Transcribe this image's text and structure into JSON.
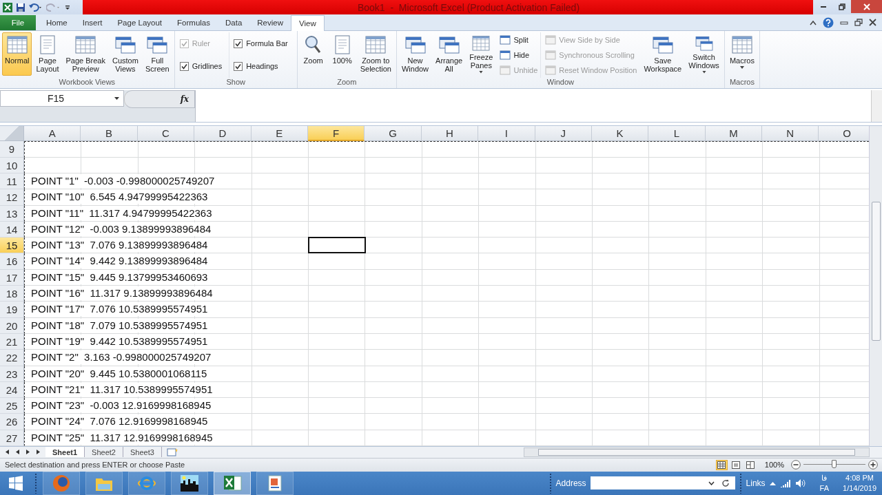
{
  "window": {
    "title": "Book1  -  Microsoft Excel (Product Activation Failed)"
  },
  "ribbon_tabs": [
    {
      "label": "File",
      "kind": "file",
      "selected": false
    },
    {
      "label": "Home",
      "kind": "tab",
      "selected": false
    },
    {
      "label": "Insert",
      "kind": "tab",
      "selected": false
    },
    {
      "label": "Page Layout",
      "kind": "tab",
      "selected": false
    },
    {
      "label": "Formulas",
      "kind": "tab",
      "selected": false
    },
    {
      "label": "Data",
      "kind": "tab",
      "selected": false
    },
    {
      "label": "Review",
      "kind": "tab",
      "selected": false
    },
    {
      "label": "View",
      "kind": "tab",
      "selected": true
    }
  ],
  "ribbon_groups": [
    {
      "label": "Workbook Views",
      "items": [
        {
          "kind": "large",
          "lines": [
            "Normal"
          ],
          "selected": true,
          "dropdown": false
        },
        {
          "kind": "large",
          "lines": [
            "Page",
            "Layout"
          ],
          "selected": false,
          "dropdown": false
        },
        {
          "kind": "large",
          "lines": [
            "Page Break",
            "Preview"
          ],
          "selected": false,
          "dropdown": false
        },
        {
          "kind": "large",
          "lines": [
            "Custom",
            "Views"
          ],
          "selected": false,
          "dropdown": false
        },
        {
          "kind": "large",
          "lines": [
            "Full",
            "Screen"
          ],
          "selected": false,
          "dropdown": false
        }
      ]
    },
    {
      "label": "Show",
      "items": [
        {
          "kind": "stack",
          "items": [
            {
              "kind": "check",
              "label": "Ruler",
              "checked": true,
              "disabled": true
            },
            {
              "kind": "check",
              "label": "Gridlines",
              "checked": true,
              "disabled": false
            }
          ]
        },
        {
          "kind": "stack",
          "items": [
            {
              "kind": "check",
              "label": "Formula Bar",
              "checked": true,
              "disabled": false
            },
            {
              "kind": "check",
              "label": "Headings",
              "checked": true,
              "disabled": false
            }
          ]
        }
      ]
    },
    {
      "label": "Zoom",
      "items": [
        {
          "kind": "large",
          "lines": [
            "Zoom"
          ],
          "selected": false,
          "dropdown": false
        },
        {
          "kind": "large",
          "lines": [
            "100%"
          ],
          "selected": false,
          "dropdown": false
        },
        {
          "kind": "large",
          "lines": [
            "Zoom to",
            "Selection"
          ],
          "selected": false,
          "dropdown": false
        }
      ]
    },
    {
      "label": "Window",
      "items": [
        {
          "kind": "large",
          "lines": [
            "New",
            "Window"
          ],
          "selected": false,
          "dropdown": false
        },
        {
          "kind": "large",
          "lines": [
            "Arrange",
            "All"
          ],
          "selected": false,
          "dropdown": false
        },
        {
          "kind": "large",
          "lines": [
            "Freeze",
            "Panes"
          ],
          "selected": false,
          "dropdown": true
        },
        {
          "kind": "stack",
          "items": [
            {
              "kind": "small",
              "label": "Split",
              "disabled": false
            },
            {
              "kind": "small",
              "label": "Hide",
              "disabled": false
            },
            {
              "kind": "small",
              "label": "Unhide",
              "disabled": true
            }
          ]
        },
        {
          "kind": "stack",
          "items": [
            {
              "kind": "small",
              "label": "View Side by Side",
              "disabled": true
            },
            {
              "kind": "small",
              "label": "Synchronous Scrolling",
              "disabled": true
            },
            {
              "kind": "small",
              "label": "Reset Window Position",
              "disabled": true
            }
          ]
        },
        {
          "kind": "large",
          "lines": [
            "Save",
            "Workspace"
          ],
          "selected": false,
          "dropdown": false
        },
        {
          "kind": "large",
          "lines": [
            "Switch",
            "Windows"
          ],
          "selected": false,
          "dropdown": true
        }
      ]
    },
    {
      "label": "Macros",
      "items": [
        {
          "kind": "large",
          "lines": [
            "Macros"
          ],
          "selected": false,
          "dropdown": true
        }
      ]
    }
  ],
  "name_box": "F15",
  "function_label": "fx",
  "columns": [
    {
      "label": "A",
      "selected": false
    },
    {
      "label": "B",
      "selected": false
    },
    {
      "label": "C",
      "selected": false
    },
    {
      "label": "D",
      "selected": false
    },
    {
      "label": "E",
      "selected": false
    },
    {
      "label": "F",
      "selected": true
    },
    {
      "label": "G",
      "selected": false
    },
    {
      "label": "H",
      "selected": false
    },
    {
      "label": "I",
      "selected": false
    },
    {
      "label": "J",
      "selected": false
    },
    {
      "label": "K",
      "selected": false
    },
    {
      "label": "L",
      "selected": false
    },
    {
      "label": "M",
      "selected": false
    },
    {
      "label": "N",
      "selected": false
    },
    {
      "label": "O",
      "selected": false
    }
  ],
  "rows": [
    {
      "label": "9",
      "selected": false
    },
    {
      "label": "10",
      "selected": false
    },
    {
      "label": "11",
      "selected": false,
      "cell_a": "POINT \"1\"  -0.003 -0.998000025749207"
    },
    {
      "label": "12",
      "selected": false,
      "cell_a": "POINT \"10\"  6.545 4.94799995422363"
    },
    {
      "label": "13",
      "selected": false,
      "cell_a": "POINT \"11\"  11.317 4.94799995422363"
    },
    {
      "label": "14",
      "selected": false,
      "cell_a": "POINT \"12\"  -0.003 9.13899993896484"
    },
    {
      "label": "15",
      "selected": true,
      "cell_a": "POINT \"13\"  7.076 9.13899993896484"
    },
    {
      "label": "16",
      "selected": false,
      "cell_a": "POINT \"14\"  9.442 9.13899993896484"
    },
    {
      "label": "17",
      "selected": false,
      "cell_a": "POINT \"15\"  9.445 9.13799953460693"
    },
    {
      "label": "18",
      "selected": false,
      "cell_a": "POINT \"16\"  11.317 9.13899993896484"
    },
    {
      "label": "19",
      "selected": false,
      "cell_a": "POINT \"17\"  7.076 10.5389995574951"
    },
    {
      "label": "20",
      "selected": false,
      "cell_a": "POINT \"18\"  7.079 10.5389995574951"
    },
    {
      "label": "21",
      "selected": false,
      "cell_a": "POINT \"19\"  9.442 10.5389995574951"
    },
    {
      "label": "22",
      "selected": false,
      "cell_a": "POINT \"2\"  3.163 -0.998000025749207"
    },
    {
      "label": "23",
      "selected": false,
      "cell_a": "POINT \"20\"  9.445 10.5380001068115"
    },
    {
      "label": "24",
      "selected": false,
      "cell_a": "POINT \"21\"  11.317 10.5389995574951"
    },
    {
      "label": "25",
      "selected": false,
      "cell_a": "POINT \"23\"  -0.003 12.9169998168945"
    },
    {
      "label": "26",
      "selected": false,
      "cell_a": "POINT \"24\"  7.076 12.9169998168945"
    },
    {
      "label": "27",
      "selected": false,
      "cell_a": "POINT \"25\"  11.317 12.9169998168945"
    }
  ],
  "sheet_tabs": [
    {
      "label": "Sheet1",
      "selected": true
    },
    {
      "label": "Sheet2",
      "selected": false
    },
    {
      "label": "Sheet3",
      "selected": false
    }
  ],
  "status_bar": {
    "message": "Select destination and press ENTER or choose Paste",
    "view_buttons": [
      {
        "selected": true
      },
      {
        "selected": false
      },
      {
        "selected": false
      }
    ],
    "zoom": "100%",
    "zoom_slider": {
      "level": 0.5
    }
  },
  "taskbar": {
    "apps": [
      {
        "selected": false
      },
      {
        "selected": false
      },
      {
        "selected": false
      },
      {
        "selected": false
      },
      {
        "selected": true
      },
      {
        "selected": false
      }
    ],
    "address_label": "Address",
    "links_label": "Links",
    "language_native": "فا",
    "language": "FA",
    "time": "4:08 PM",
    "date": "1/14/2019"
  }
}
